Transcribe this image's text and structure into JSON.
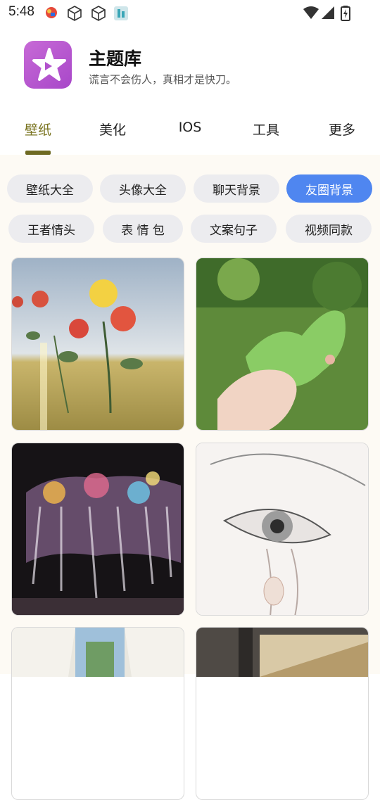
{
  "status_bar": {
    "time": "5:48",
    "left_icons": [
      "app-notification-icon",
      "cube-icon",
      "cube-icon",
      "app-notification-icon"
    ],
    "right_icons": [
      "wifi-icon",
      "cellular-signal-icon",
      "battery-charging-icon"
    ]
  },
  "header": {
    "title": "主题库",
    "subtitle": "谎言不会伤人，真相才是快刀。",
    "logo_icon": "star-logo-icon"
  },
  "tabs": [
    {
      "label": "壁纸",
      "active": true
    },
    {
      "label": "美化",
      "active": false
    },
    {
      "label": "IOS",
      "active": false
    },
    {
      "label": "工具",
      "active": false
    },
    {
      "label": "更多",
      "active": false
    }
  ],
  "chips": [
    {
      "label": "壁纸大全",
      "selected": false
    },
    {
      "label": "头像大全",
      "selected": false
    },
    {
      "label": "聊天背景",
      "selected": false
    },
    {
      "label": "友圈背景",
      "selected": true
    },
    {
      "label": "王者情头",
      "selected": false
    },
    {
      "label": "表 情 包",
      "selected": false
    },
    {
      "label": "文案句子",
      "selected": false
    },
    {
      "label": "视频同款",
      "selected": false
    }
  ],
  "colors": {
    "accent": "#4f86f0",
    "active_tab": "#7a7420",
    "logo_gradient_start": "#c76ad6",
    "logo_gradient_end": "#a847c9"
  },
  "thumbnails": [
    {
      "subject": "roses-in-grass"
    },
    {
      "subject": "hand-holding-butterfly-mirror"
    },
    {
      "subject": "colorful-fireworks"
    },
    {
      "subject": "eye-sketch"
    },
    {
      "subject": "window-curtains"
    },
    {
      "subject": "window-view"
    }
  ]
}
